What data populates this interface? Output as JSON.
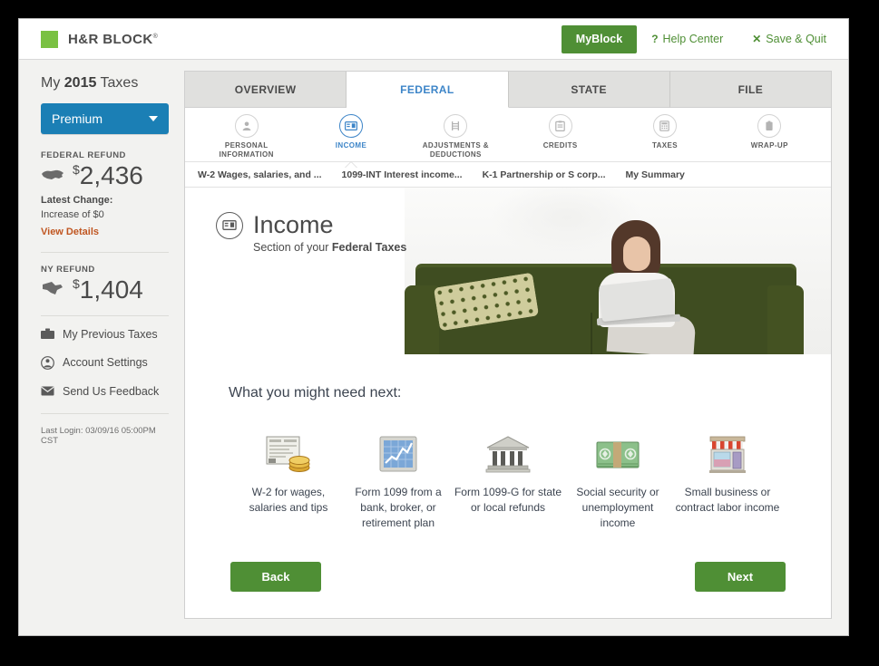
{
  "topbar": {
    "brand": "H&R BLOCK",
    "brand_tm": "®",
    "myblock": "MyBlock",
    "help_center": "Help Center",
    "help_icon": "question-mark-icon",
    "save_quit": "Save & Quit",
    "save_quit_icon": "close-x-icon",
    "brand_color": "#7ac143",
    "link_color": "#4f8f35"
  },
  "sidebar": {
    "title_pre": "My ",
    "title_year": "2015",
    "title_post": " Taxes",
    "product": "Premium",
    "product_color": "#1b7fb5",
    "federal": {
      "label": "FEDERAL REFUND",
      "icon": "us-map-icon",
      "currency": "$",
      "amount": "2,436"
    },
    "latest_change_label": "Latest Change:",
    "latest_change_value": "Increase of $0",
    "view_details": "View Details",
    "view_details_color": "#c05621",
    "state": {
      "label": "NY REFUND",
      "icon": "ny-state-icon",
      "currency": "$",
      "amount": "1,404"
    },
    "links": [
      {
        "label": "My Previous Taxes",
        "icon": "briefcase-icon"
      },
      {
        "label": "Account Settings",
        "icon": "account-circle-icon"
      },
      {
        "label": "Send Us Feedback",
        "icon": "envelope-icon"
      }
    ],
    "last_login": "Last Login: 03/09/16 05:00PM CST"
  },
  "tabs": [
    {
      "label": "OVERVIEW",
      "active": false
    },
    {
      "label": "FEDERAL",
      "active": true
    },
    {
      "label": "STATE",
      "active": false
    },
    {
      "label": "FILE",
      "active": false
    }
  ],
  "subnav": [
    {
      "label": "PERSONAL\nINFORMATION",
      "line1": "PERSONAL",
      "line2": "INFORMATION",
      "icon": "person-icon",
      "active": false
    },
    {
      "label": "INCOME",
      "line1": "INCOME",
      "line2": "",
      "icon": "income-card-icon",
      "active": true
    },
    {
      "label": "ADJUSTMENTS & DEDUCTIONS",
      "line1": "ADJUSTMENTS &",
      "line2": "DEDUCTIONS",
      "icon": "ladder-icon",
      "active": false
    },
    {
      "label": "CREDITS",
      "line1": "CREDITS",
      "line2": "",
      "icon": "clipboard-icon",
      "active": false
    },
    {
      "label": "TAXES",
      "line1": "TAXES",
      "line2": "",
      "icon": "calculator-icon",
      "active": false
    },
    {
      "label": "WRAP-UP",
      "line1": "WRAP-UP",
      "line2": "",
      "icon": "document-icon",
      "active": false
    }
  ],
  "crumbs": [
    "W-2 Wages, salaries, and ...",
    "1099-INT Interest income...",
    "K-1 Partnership or S corp...",
    "My Summary"
  ],
  "hero": {
    "title": "Income",
    "sub_pre": "Section of your ",
    "sub_bold": "Federal Taxes",
    "icon": "income-card-icon",
    "photo_alt": "woman-on-couch-with-laptop-photo"
  },
  "lower": {
    "heading": "What you might need next:",
    "cards": [
      {
        "icon": "w2-form-coins-icon",
        "label": "W-2 for wages, salaries and tips"
      },
      {
        "icon": "chart-1099-icon",
        "label": "Form 1099 from a bank, broker, or retirement plan"
      },
      {
        "icon": "government-building-icon",
        "label": "Form 1099-G for state or local refunds"
      },
      {
        "icon": "cash-money-icon",
        "label": "Social security or unemployment income"
      },
      {
        "icon": "storefront-icon",
        "label": "Small business or contract labor income"
      }
    ],
    "back": "Back",
    "next": "Next",
    "button_color": "#4f8f35"
  }
}
